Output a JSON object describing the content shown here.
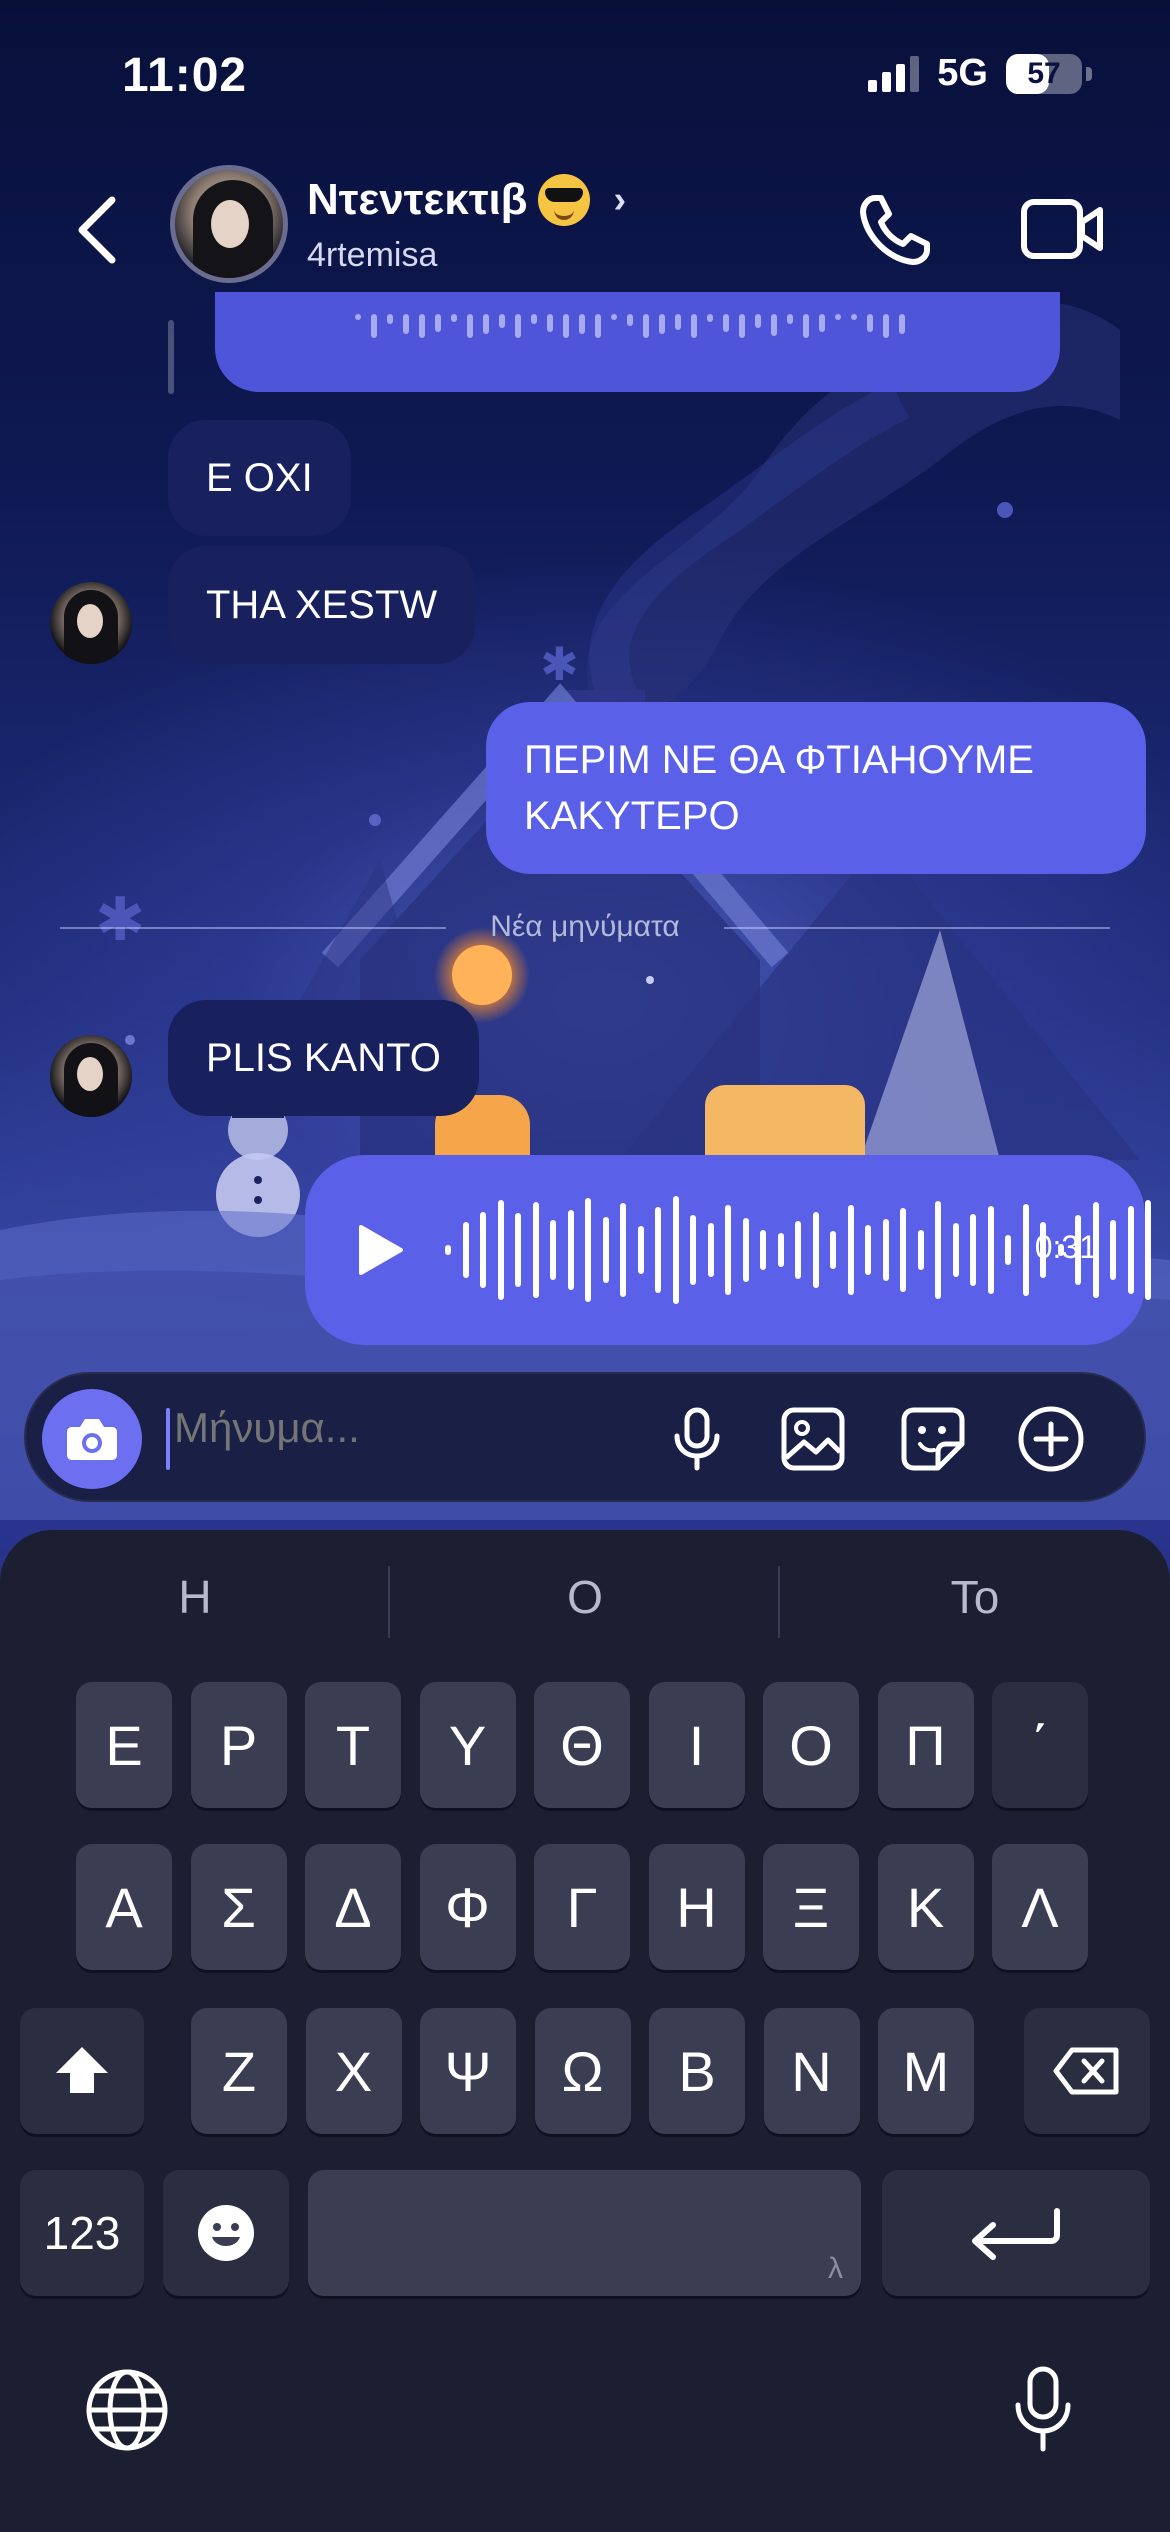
{
  "status_bar": {
    "time": "11:02",
    "network": "5G",
    "battery": "57",
    "battery_level": 0.57,
    "signal_bars_active": 3,
    "signal_bars_total": 4
  },
  "header": {
    "contact_name": "Ντεντεκτιβ",
    "contact_emoji": "smiling-face-with-sunglasses",
    "username": "4rtemisa",
    "back_icon": "chevron-left-icon",
    "profile_chevron": "›",
    "call_icon": "phone-icon",
    "video_icon": "video-camera-icon"
  },
  "messages": [
    {
      "id": "m1",
      "direction": "incoming",
      "type": "text",
      "text": "E OXI"
    },
    {
      "id": "m2",
      "direction": "incoming",
      "type": "text",
      "text": "THA XESTW"
    },
    {
      "id": "m3",
      "direction": "outgoing",
      "type": "text",
      "lines": [
        "ΠΕΡΙΜ ΝΕ ΘΑ ΦΤΙΑΗΟΥΜΕ",
        "ΚΑΚΥΤΕΡΟ"
      ]
    },
    {
      "id": "m4",
      "direction": "incoming",
      "type": "text",
      "text": "PLIS KANTO"
    },
    {
      "id": "m5",
      "direction": "outgoing",
      "type": "voice",
      "duration": "0:31"
    }
  ],
  "new_messages_divider": "Νέα μηνύματα",
  "composer": {
    "placeholder": "Μήνυμα...",
    "icons": [
      "camera-icon",
      "microphone-icon",
      "image-icon",
      "sticker-icon",
      "plus-icon"
    ]
  },
  "keyboard": {
    "suggestions": [
      "Η",
      "Ο",
      "Το"
    ],
    "row1": [
      "Ε",
      "Ρ",
      "Τ",
      "Υ",
      "Θ",
      "Ι",
      "Ο",
      "Π",
      "΄"
    ],
    "row2": [
      "Α",
      "Σ",
      "Δ",
      "Φ",
      "Γ",
      "Η",
      "Ξ",
      "Κ",
      "Λ"
    ],
    "row3": [
      "Ζ",
      "Χ",
      "Ψ",
      "Ω",
      "Β",
      "Ν",
      "Μ"
    ],
    "numbers_key": "123",
    "space_hint": "λ",
    "shift_icon": "shift-arrow-icon",
    "backspace_icon": "backspace-icon",
    "emoji_icon": "emoji-icon",
    "return_icon": "return-arrow-icon",
    "globe_icon": "globe-icon",
    "dictation_icon": "microphone-icon"
  },
  "colors": {
    "outgoing_bubble": "#5a60e8",
    "incoming_bubble": "#18205e",
    "accent": "#6b6ff0",
    "keyboard_bg": "#1c1f32",
    "key_bg": "#3b3e52"
  }
}
